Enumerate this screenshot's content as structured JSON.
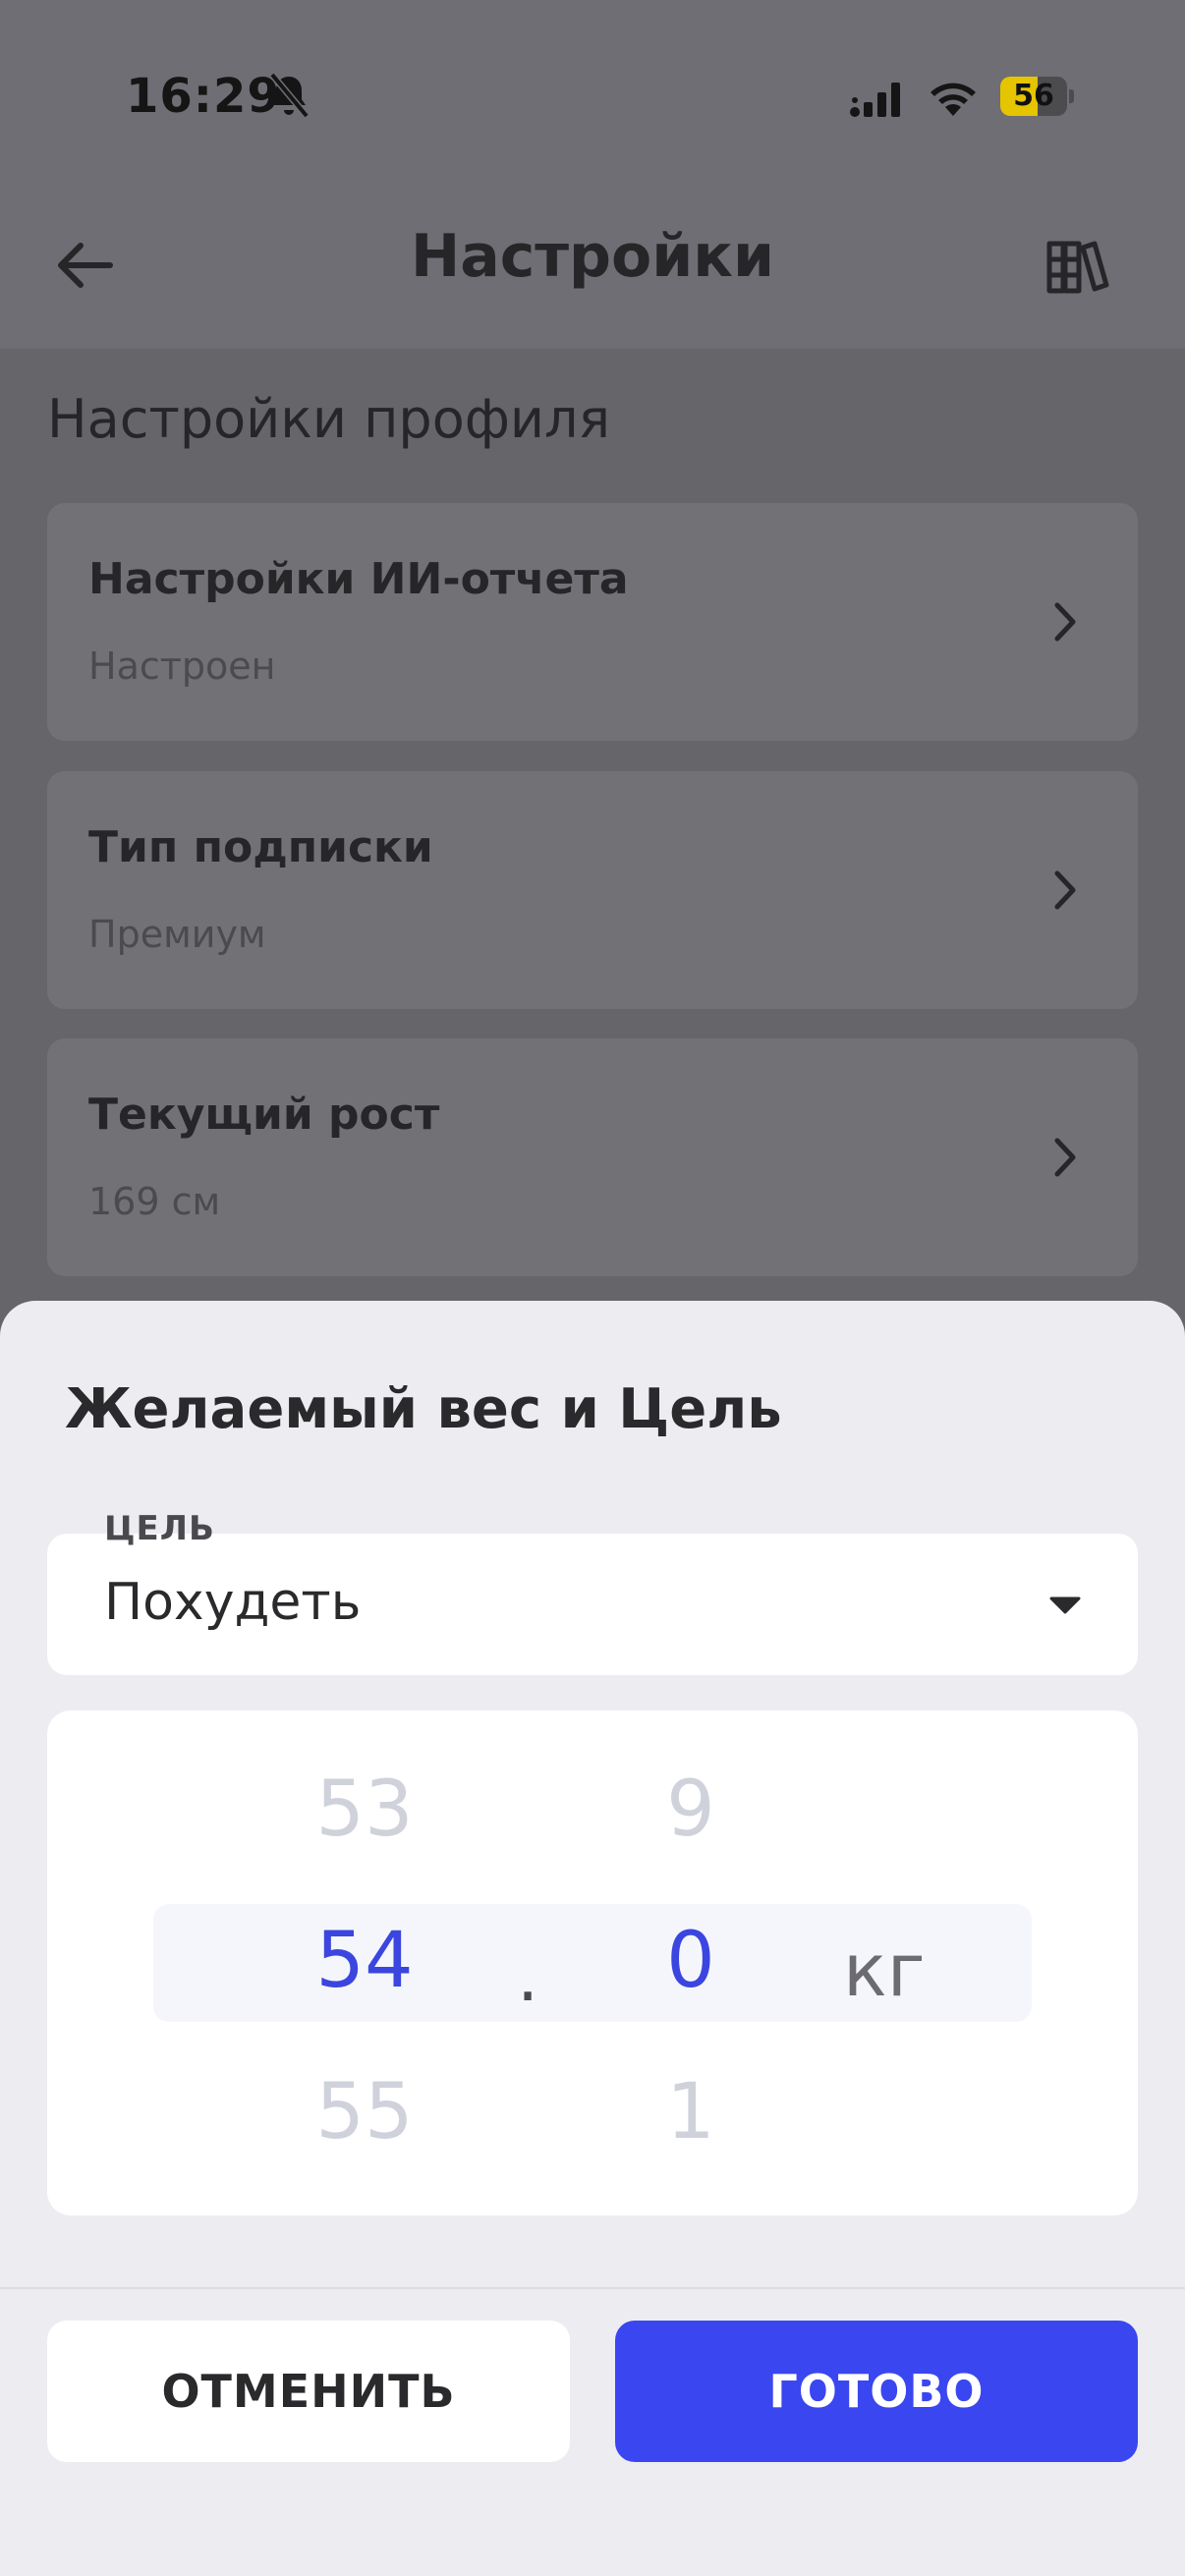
{
  "status_bar": {
    "time": "16:29",
    "battery": "56",
    "battery_level_percent": 56
  },
  "nav": {
    "title": "Настройки"
  },
  "profile": {
    "section_title": "Настройки профиля",
    "cards": [
      {
        "title": "Настройки ИИ-отчета",
        "subtitle": "Настроен"
      },
      {
        "title": "Тип подписки",
        "subtitle": "Премиум"
      },
      {
        "title": "Текущий рост",
        "subtitle": "169 см"
      }
    ]
  },
  "sheet": {
    "title": "Желаемый вес и Цель",
    "goal": {
      "label": "ЦЕЛЬ",
      "value": "Похудеть"
    },
    "picker": {
      "kg": {
        "prev": "53",
        "selected": "54",
        "next": "55"
      },
      "separator": ".",
      "decimal": {
        "prev": "9",
        "selected": "0",
        "next": "1"
      },
      "unit": "кг"
    },
    "cancel_label": "ОТМЕНИТЬ",
    "done_label": "ГОТОВО"
  },
  "colors": {
    "accent": "#3a46f0",
    "selected_value": "#3b45e0",
    "sheet_bg": "#ededf1",
    "overlay": "#6f6e74"
  }
}
